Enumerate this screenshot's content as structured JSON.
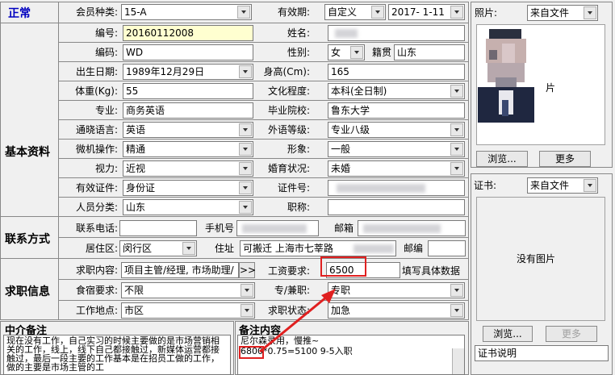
{
  "status": "正常",
  "sections": {
    "basic": "基本资料",
    "contact": "联系方式",
    "job": "求职信息",
    "agent_note": "中介备注",
    "remark": "备注内容"
  },
  "fields": {
    "member_type": {
      "label": "会员种类:",
      "value": "15-A"
    },
    "validity": {
      "label": "有效期:",
      "value": "自定义",
      "date": "2017- 1-11"
    },
    "number": {
      "label": "编号:",
      "value": "20160112008"
    },
    "name": {
      "label": "姓名:",
      "value": ""
    },
    "code": {
      "label": "编码:",
      "value": "WD"
    },
    "gender": {
      "label": "性别:",
      "value": "女"
    },
    "native": {
      "label": "籍贯",
      "value": "山东"
    },
    "birth": {
      "label": "出生日期:",
      "value": "1989年12月29日"
    },
    "height": {
      "label": "身高(Cm):",
      "value": "165"
    },
    "weight": {
      "label": "体重(Kg):",
      "value": "55"
    },
    "education": {
      "label": "文化程度:",
      "value": "本科(全日制)"
    },
    "major": {
      "label": "专业:",
      "value": "商务英语"
    },
    "school": {
      "label": "毕业院校:",
      "value": "鲁东大学"
    },
    "language": {
      "label": "通晓语言:",
      "value": "英语"
    },
    "foreign_level": {
      "label": "外语等级:",
      "value": "专业八级"
    },
    "computer": {
      "label": "微机操作:",
      "value": "精通"
    },
    "appearance": {
      "label": "形象:",
      "value": "一般"
    },
    "vision": {
      "label": "视力:",
      "value": "近视"
    },
    "marital": {
      "label": "婚育状况:",
      "value": "未婚"
    },
    "id_type": {
      "label": "有效证件:",
      "value": "身份证"
    },
    "id_number": {
      "label": "证件号:",
      "value": ""
    },
    "person_type": {
      "label": "人员分类:",
      "value": "山东"
    },
    "title": {
      "label": "职称:",
      "value": ""
    },
    "phone": {
      "label": "联系电话:",
      "value": ""
    },
    "mobile": {
      "label": "手机号",
      "value": ""
    },
    "mailbox": {
      "label": "邮箱",
      "value": ""
    },
    "district": {
      "label": "居住区:",
      "value": "闵行区"
    },
    "address": {
      "label": "住址",
      "value": "可搬迁  上海市七莘路"
    },
    "postcode": {
      "label": "邮编",
      "value": ""
    },
    "job_content": {
      "label": "求职内容:",
      "value": "项目主管/经理, 市场助理/"
    },
    "salary": {
      "label": "工资要求:",
      "value": "6500",
      "hint": "填写具体数据"
    },
    "board": {
      "label": "食宿要求:",
      "value": "不限"
    },
    "fulltime": {
      "label": "专/兼职:",
      "value": "专职"
    },
    "location": {
      "label": "工作地点:",
      "value": "市区"
    },
    "job_status": {
      "label": "求职状态:",
      "value": "加急"
    }
  },
  "photo": {
    "label": "照片:",
    "source": "来自文件",
    "placeholder": "片",
    "browse": "浏览...",
    "more": "更多"
  },
  "cert": {
    "label": "证书:",
    "source": "来自文件",
    "placeholder": "没有图片",
    "browse": "浏览...",
    "more": "更多",
    "desc": "证书说明"
  },
  "agent_note_text": "现在没有工作，自己实习的时候主要做的是市场营销相关的工作，线上，线下自己都接触过，新媒体运营都接触过，最后一段主要的工作基本是在招员工做的工作，做的主要是市场主管的工",
  "remark_line1": "尼尔森录用，慢推~",
  "remark_line2_prefix": "6800",
  "remark_line2_rest": "*0.75=5100      9-5入职",
  "more_button": ">>",
  "colors": {
    "status": "#0000c0",
    "highlight": "#e02020"
  }
}
